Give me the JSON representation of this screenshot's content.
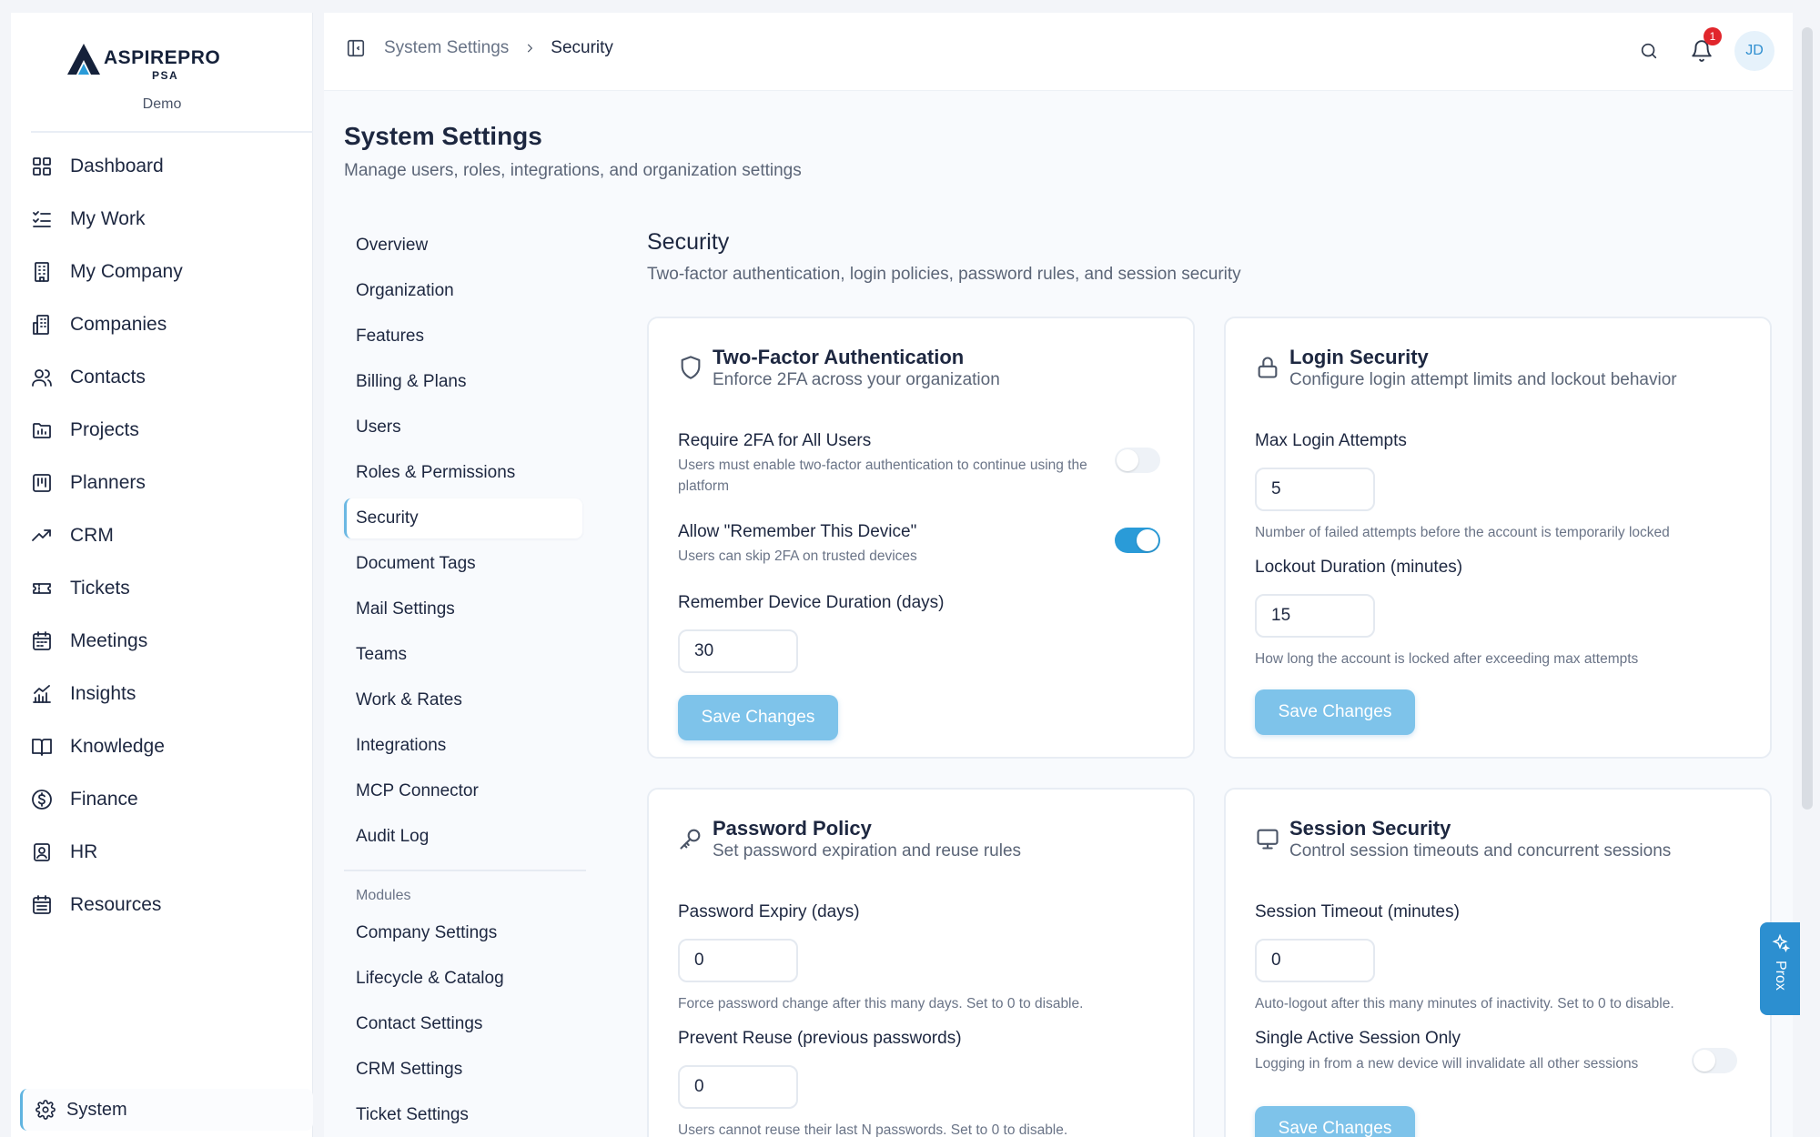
{
  "brand": {
    "name": "ASPIREPRO",
    "sub": "PSA",
    "tenant": "Demo"
  },
  "nav": [
    {
      "label": "Dashboard",
      "icon": "grid-icon"
    },
    {
      "label": "My Work",
      "icon": "checklist-icon"
    },
    {
      "label": "My Company",
      "icon": "building-icon"
    },
    {
      "label": "Companies",
      "icon": "buildings-icon"
    },
    {
      "label": "Contacts",
      "icon": "users-icon"
    },
    {
      "label": "Projects",
      "icon": "folder-chart-icon"
    },
    {
      "label": "Planners",
      "icon": "kanban-icon"
    },
    {
      "label": "CRM",
      "icon": "trending-up-icon"
    },
    {
      "label": "Tickets",
      "icon": "ticket-icon"
    },
    {
      "label": "Meetings",
      "icon": "calendar-icon"
    },
    {
      "label": "Insights",
      "icon": "bar-chart-icon"
    },
    {
      "label": "Knowledge",
      "icon": "book-icon"
    },
    {
      "label": "Finance",
      "icon": "dollar-circle-icon"
    },
    {
      "label": "HR",
      "icon": "id-badge-icon"
    },
    {
      "label": "Resources",
      "icon": "calendar-list-icon"
    }
  ],
  "system_item": {
    "label": "System",
    "icon": "gear-icon"
  },
  "breadcrumb": {
    "parent": "System Settings",
    "current": "Security"
  },
  "notifications": {
    "count": "1"
  },
  "user": {
    "initials": "JD"
  },
  "page": {
    "title": "System Settings",
    "subtitle": "Manage users, roles, integrations, and organization settings"
  },
  "settings_menu": [
    "Overview",
    "Organization",
    "Features",
    "Billing & Plans",
    "Users",
    "Roles & Permissions",
    "Security",
    "Document Tags",
    "Mail Settings",
    "Teams",
    "Work & Rates",
    "Integrations",
    "MCP Connector",
    "Audit Log"
  ],
  "settings_active": "Security",
  "modules_heading": "Modules",
  "modules_menu": [
    "Company Settings",
    "Lifecycle & Catalog",
    "Contact Settings",
    "CRM Settings",
    "Ticket Settings"
  ],
  "section": {
    "title": "Security",
    "subtitle": "Two-factor authentication, login policies, password rules, and session security"
  },
  "two_factor": {
    "title": "Two-Factor Authentication",
    "desc": "Enforce 2FA across your organization",
    "require_label": "Require 2FA for All Users",
    "require_help": "Users must enable two-factor authentication to continue using the platform",
    "require_on": false,
    "remember_label": "Allow \"Remember This Device\"",
    "remember_help": "Users can skip 2FA on trusted devices",
    "remember_on": true,
    "duration_label": "Remember Device Duration (days)",
    "duration_value": "30",
    "save": "Save Changes"
  },
  "login_security": {
    "title": "Login Security",
    "desc": "Configure login attempt limits and lockout behavior",
    "max_label": "Max Login Attempts",
    "max_value": "5",
    "max_help": "Number of failed attempts before the account is temporarily locked",
    "lockout_label": "Lockout Duration (minutes)",
    "lockout_value": "15",
    "lockout_help": "How long the account is locked after exceeding max attempts",
    "save": "Save Changes"
  },
  "password_policy": {
    "title": "Password Policy",
    "desc": "Set password expiration and reuse rules",
    "expiry_label": "Password Expiry (days)",
    "expiry_value": "0",
    "expiry_help": "Force password change after this many days. Set to 0 to disable.",
    "reuse_label": "Prevent Reuse (previous passwords)",
    "reuse_value": "0",
    "reuse_help": "Users cannot reuse their last N passwords. Set to 0 to disable."
  },
  "session_security": {
    "title": "Session Security",
    "desc": "Control session timeouts and concurrent sessions",
    "timeout_label": "Session Timeout (minutes)",
    "timeout_value": "0",
    "timeout_help": "Auto-logout after this many minutes of inactivity. Set to 0 to disable.",
    "single_label": "Single Active Session Only",
    "single_help": "Logging in from a new device will invalidate all other sessions",
    "single_on": false,
    "save": "Save Changes"
  },
  "assistant_tab": {
    "label": "Prox"
  },
  "colors": {
    "accent": "#2a9bd8",
    "button": "#7ec3ea",
    "badge": "#e1262c"
  }
}
